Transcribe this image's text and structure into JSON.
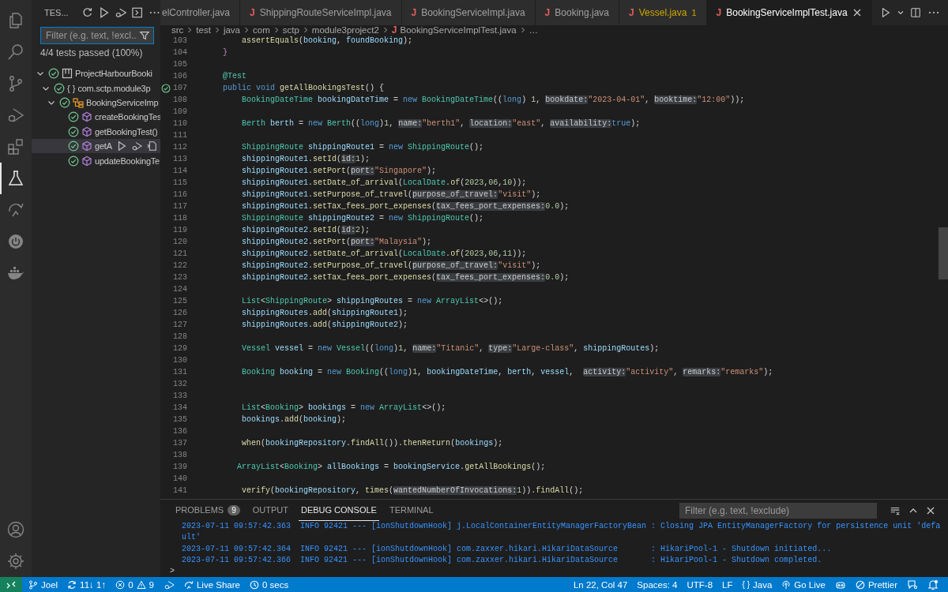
{
  "activity_bar": {
    "items": [
      {
        "kind": "files",
        "selected": false
      },
      {
        "kind": "search",
        "selected": false
      },
      {
        "kind": "source-control",
        "selected": false
      },
      {
        "kind": "run-debug",
        "selected": false
      },
      {
        "kind": "extensions",
        "selected": false
      },
      {
        "kind": "testing",
        "selected": true
      },
      {
        "kind": "remote",
        "selected": false
      },
      {
        "kind": "power",
        "selected": false
      },
      {
        "kind": "whale",
        "selected": false
      }
    ],
    "bottom_items": [
      {
        "kind": "account"
      },
      {
        "kind": "settings"
      }
    ]
  },
  "test_panel": {
    "title": "TES...",
    "filter": {
      "placeholder": "Filter (e.g. text, !excl..."
    },
    "summary": "4/4 tests passed (100%)",
    "tree": [
      {
        "label": "ProjectHarbourBooki",
        "kind": "project",
        "passed": true,
        "expanded": true,
        "selected": false,
        "children": [
          {
            "label": "com.sctp.module3p",
            "kind": "package",
            "glyph": "{ }",
            "passed": true,
            "expanded": true,
            "selected": false,
            "children": [
              {
                "label": "BookingServiceImp",
                "kind": "class",
                "passed": true,
                "expanded": true,
                "selected": false,
                "children": [
                  {
                    "label": "createBookingTes",
                    "kind": "method",
                    "passed": true,
                    "selected": false
                  },
                  {
                    "label": "getBookingTest()",
                    "kind": "method",
                    "passed": true,
                    "selected": false
                  },
                  {
                    "label": "getA",
                    "kind": "method",
                    "passed": true,
                    "selected": true
                  },
                  {
                    "label": "updateBookingTe",
                    "kind": "method",
                    "passed": true,
                    "selected": false
                  }
                ]
              }
            ]
          }
        ]
      }
    ]
  },
  "tabs": [
    {
      "label": "elController.java",
      "selected": false
    },
    {
      "icon": "J",
      "label": "ShippingRouteServiceImpl.java",
      "selected": false
    },
    {
      "icon": "J",
      "label": "BookingServiceImpl.java",
      "selected": false
    },
    {
      "icon": "J",
      "label": "Booking.java",
      "selected": false
    },
    {
      "icon": "J",
      "label": "Vessel.java",
      "selected": false,
      "warning_count": "1"
    },
    {
      "icon": "J",
      "label": "BookingServiceImplTest.java",
      "selected": true
    }
  ],
  "breadcrumb": {
    "segments": [
      "src",
      "test",
      "java",
      "com",
      "sctp",
      "module3project2"
    ],
    "file_icon": "J",
    "file": "BookingServiceImplTest.java",
    "more": "…"
  },
  "editor": {
    "lines": [
      {
        "number": "103",
        "tokens": [
          {
            "text": "        assertEquals",
            "kind": "function"
          },
          {
            "text": "(",
            "kind": "plain"
          },
          {
            "text": "booking",
            "kind": "variable"
          },
          {
            "text": ", ",
            "kind": "plain"
          },
          {
            "text": "foundBooking",
            "kind": "variable"
          },
          {
            "text": ");",
            "kind": "plain"
          }
        ]
      },
      {
        "number": "104",
        "tokens": [
          {
            "text": "    }",
            "kind": "brace"
          }
        ]
      },
      {
        "number": "105"
      },
      {
        "number": "106",
        "tokens": [
          {
            "text": "    @Test",
            "kind": "type"
          }
        ]
      },
      {
        "number": "107",
        "gutter_passed": true,
        "tokens": [
          {
            "text": "    public void ",
            "kind": "keyword"
          },
          {
            "text": "getAllBookingsTest",
            "kind": "function"
          },
          {
            "text": "() {",
            "kind": "plain"
          }
        ]
      },
      {
        "number": "108",
        "tokens": [
          {
            "text": "        BookingDateTime ",
            "kind": "type"
          },
          {
            "text": "bookingDateTime",
            "kind": "variable"
          },
          {
            "text": " = ",
            "kind": "plain"
          },
          {
            "text": "new ",
            "kind": "keyword"
          },
          {
            "text": "BookingDateTime",
            "kind": "type"
          },
          {
            "text": "((",
            "kind": "plain"
          },
          {
            "text": "long",
            "kind": "keyword"
          },
          {
            "text": ") ",
            "kind": "plain"
          },
          {
            "text": "1",
            "kind": "number"
          },
          {
            "text": ", ",
            "kind": "plain"
          },
          {
            "text": "bookdate:",
            "kind": "hint"
          },
          {
            "text": "\"2023-04-01\"",
            "kind": "string"
          },
          {
            "text": ", ",
            "kind": "plain"
          },
          {
            "text": "booktime:",
            "kind": "hint"
          },
          {
            "text": "\"12:00\"",
            "kind": "string"
          },
          {
            "text": "));",
            "kind": "plain"
          }
        ]
      },
      {
        "number": "109"
      },
      {
        "number": "110",
        "tokens": [
          {
            "text": "        Berth ",
            "kind": "type"
          },
          {
            "text": "berth",
            "kind": "variable"
          },
          {
            "text": " = ",
            "kind": "plain"
          },
          {
            "text": "new ",
            "kind": "keyword"
          },
          {
            "text": "Berth",
            "kind": "type"
          },
          {
            "text": "((",
            "kind": "plain"
          },
          {
            "text": "long",
            "kind": "keyword"
          },
          {
            "text": ")",
            "kind": "plain"
          },
          {
            "text": "1",
            "kind": "number"
          },
          {
            "text": ", ",
            "kind": "plain"
          },
          {
            "text": "name:",
            "kind": "hint"
          },
          {
            "text": "\"berth1\"",
            "kind": "string"
          },
          {
            "text": ", ",
            "kind": "plain"
          },
          {
            "text": "location:",
            "kind": "hint"
          },
          {
            "text": "\"east\"",
            "kind": "string"
          },
          {
            "text": ", ",
            "kind": "plain"
          },
          {
            "text": "availability:",
            "kind": "hint"
          },
          {
            "text": "true",
            "kind": "keyword"
          },
          {
            "text": ");",
            "kind": "plain"
          }
        ]
      },
      {
        "number": "111"
      },
      {
        "number": "112",
        "tokens": [
          {
            "text": "        ShippingRoute ",
            "kind": "type"
          },
          {
            "text": "shippingRoute1",
            "kind": "variable"
          },
          {
            "text": " = ",
            "kind": "plain"
          },
          {
            "text": "new ",
            "kind": "keyword"
          },
          {
            "text": "ShippingRoute",
            "kind": "type"
          },
          {
            "text": "();",
            "kind": "plain"
          }
        ]
      },
      {
        "number": "113",
        "tokens": [
          {
            "text": "        shippingRoute1",
            "kind": "variable"
          },
          {
            "text": ".",
            "kind": "plain"
          },
          {
            "text": "setId",
            "kind": "function"
          },
          {
            "text": "(",
            "kind": "plain"
          },
          {
            "text": "id:",
            "kind": "hint"
          },
          {
            "text": "1",
            "kind": "number"
          },
          {
            "text": ");",
            "kind": "plain"
          }
        ]
      },
      {
        "number": "114",
        "tokens": [
          {
            "text": "        shippingRoute1",
            "kind": "variable"
          },
          {
            "text": ".",
            "kind": "plain"
          },
          {
            "text": "setPort",
            "kind": "function"
          },
          {
            "text": "(",
            "kind": "plain"
          },
          {
            "text": "port:",
            "kind": "hint"
          },
          {
            "text": "\"Singapore\"",
            "kind": "string"
          },
          {
            "text": ");",
            "kind": "plain"
          }
        ]
      },
      {
        "number": "115",
        "tokens": [
          {
            "text": "        shippingRoute1",
            "kind": "variable"
          },
          {
            "text": ".",
            "kind": "plain"
          },
          {
            "text": "setDate_of_arrival",
            "kind": "function"
          },
          {
            "text": "(",
            "kind": "plain"
          },
          {
            "text": "LocalDate",
            "kind": "type"
          },
          {
            "text": ".",
            "kind": "plain"
          },
          {
            "text": "of",
            "kind": "function"
          },
          {
            "text": "(",
            "kind": "plain"
          },
          {
            "text": "2023",
            "kind": "number"
          },
          {
            "text": ",",
            "kind": "plain"
          },
          {
            "text": "06",
            "kind": "number"
          },
          {
            "text": ",",
            "kind": "plain"
          },
          {
            "text": "10",
            "kind": "number"
          },
          {
            "text": "));",
            "kind": "plain"
          }
        ]
      },
      {
        "number": "116",
        "tokens": [
          {
            "text": "        shippingRoute1",
            "kind": "variable"
          },
          {
            "text": ".",
            "kind": "plain"
          },
          {
            "text": "setPurpose_of_travel",
            "kind": "function"
          },
          {
            "text": "(",
            "kind": "plain"
          },
          {
            "text": "purpose_of_travel:",
            "kind": "hint"
          },
          {
            "text": "\"visit\"",
            "kind": "string"
          },
          {
            "text": ");",
            "kind": "plain"
          }
        ]
      },
      {
        "number": "117",
        "tokens": [
          {
            "text": "        shippingRoute1",
            "kind": "variable"
          },
          {
            "text": ".",
            "kind": "plain"
          },
          {
            "text": "setTax_fees_port_expenses",
            "kind": "function"
          },
          {
            "text": "(",
            "kind": "plain"
          },
          {
            "text": "tax_fees_port_expenses:",
            "kind": "hint"
          },
          {
            "text": "0.0",
            "kind": "number"
          },
          {
            "text": ");",
            "kind": "plain"
          }
        ]
      },
      {
        "number": "118",
        "tokens": [
          {
            "text": "        ShippingRoute ",
            "kind": "type"
          },
          {
            "text": "shippingRoute2",
            "kind": "variable"
          },
          {
            "text": " = ",
            "kind": "plain"
          },
          {
            "text": "new ",
            "kind": "keyword"
          },
          {
            "text": "ShippingRoute",
            "kind": "type"
          },
          {
            "text": "();",
            "kind": "plain"
          }
        ]
      },
      {
        "number": "119",
        "tokens": [
          {
            "text": "        shippingRoute2",
            "kind": "variable"
          },
          {
            "text": ".",
            "kind": "plain"
          },
          {
            "text": "setId",
            "kind": "function"
          },
          {
            "text": "(",
            "kind": "plain"
          },
          {
            "text": "id:",
            "kind": "hint"
          },
          {
            "text": "2",
            "kind": "number"
          },
          {
            "text": ");",
            "kind": "plain"
          }
        ]
      },
      {
        "number": "120",
        "tokens": [
          {
            "text": "        shippingRoute2",
            "kind": "variable"
          },
          {
            "text": ".",
            "kind": "plain"
          },
          {
            "text": "setPort",
            "kind": "function"
          },
          {
            "text": "(",
            "kind": "plain"
          },
          {
            "text": "port:",
            "kind": "hint"
          },
          {
            "text": "\"Malaysia\"",
            "kind": "string"
          },
          {
            "text": ");",
            "kind": "plain"
          }
        ]
      },
      {
        "number": "121",
        "tokens": [
          {
            "text": "        shippingRoute2",
            "kind": "variable"
          },
          {
            "text": ".",
            "kind": "plain"
          },
          {
            "text": "setDate_of_arrival",
            "kind": "function"
          },
          {
            "text": "(",
            "kind": "plain"
          },
          {
            "text": "LocalDate",
            "kind": "type"
          },
          {
            "text": ".",
            "kind": "plain"
          },
          {
            "text": "of",
            "kind": "function"
          },
          {
            "text": "(",
            "kind": "plain"
          },
          {
            "text": "2023",
            "kind": "number"
          },
          {
            "text": ",",
            "kind": "plain"
          },
          {
            "text": "06",
            "kind": "number"
          },
          {
            "text": ",",
            "kind": "plain"
          },
          {
            "text": "11",
            "kind": "number"
          },
          {
            "text": "));",
            "kind": "plain"
          }
        ]
      },
      {
        "number": "122",
        "tokens": [
          {
            "text": "        shippingRoute2",
            "kind": "variable"
          },
          {
            "text": ".",
            "kind": "plain"
          },
          {
            "text": "setPurpose_of_travel",
            "kind": "function"
          },
          {
            "text": "(",
            "kind": "plain"
          },
          {
            "text": "purpose_of_travel:",
            "kind": "hint"
          },
          {
            "text": "\"visit\"",
            "kind": "string"
          },
          {
            "text": ");",
            "kind": "plain"
          }
        ]
      },
      {
        "number": "123",
        "tokens": [
          {
            "text": "        shippingRoute2",
            "kind": "variable"
          },
          {
            "text": ".",
            "kind": "plain"
          },
          {
            "text": "setTax_fees_port_expenses",
            "kind": "function"
          },
          {
            "text": "(",
            "kind": "plain"
          },
          {
            "text": "tax_fees_port_expenses:",
            "kind": "hint"
          },
          {
            "text": "0.0",
            "kind": "number"
          },
          {
            "text": ");",
            "kind": "plain"
          }
        ]
      },
      {
        "number": "124"
      },
      {
        "number": "125",
        "tokens": [
          {
            "text": "        List",
            "kind": "type"
          },
          {
            "text": "<",
            "kind": "plain"
          },
          {
            "text": "ShippingRoute",
            "kind": "type"
          },
          {
            "text": "> ",
            "kind": "plain"
          },
          {
            "text": "shippingRoutes",
            "kind": "variable"
          },
          {
            "text": " = ",
            "kind": "plain"
          },
          {
            "text": "new ",
            "kind": "keyword"
          },
          {
            "text": "ArrayList",
            "kind": "type"
          },
          {
            "text": "<>();",
            "kind": "plain"
          }
        ]
      },
      {
        "number": "126",
        "tokens": [
          {
            "text": "        shippingRoutes",
            "kind": "variable"
          },
          {
            "text": ".",
            "kind": "plain"
          },
          {
            "text": "add",
            "kind": "function"
          },
          {
            "text": "(",
            "kind": "plain"
          },
          {
            "text": "shippingRoute1",
            "kind": "variable"
          },
          {
            "text": ");",
            "kind": "plain"
          }
        ]
      },
      {
        "number": "127",
        "tokens": [
          {
            "text": "        shippingRoutes",
            "kind": "variable"
          },
          {
            "text": ".",
            "kind": "plain"
          },
          {
            "text": "add",
            "kind": "function"
          },
          {
            "text": "(",
            "kind": "plain"
          },
          {
            "text": "shippingRoute2",
            "kind": "variable"
          },
          {
            "text": ");",
            "kind": "plain"
          }
        ]
      },
      {
        "number": "128"
      },
      {
        "number": "129",
        "tokens": [
          {
            "text": "        Vessel ",
            "kind": "type"
          },
          {
            "text": "vessel",
            "kind": "variable"
          },
          {
            "text": " = ",
            "kind": "plain"
          },
          {
            "text": "new ",
            "kind": "keyword"
          },
          {
            "text": "Vessel",
            "kind": "type"
          },
          {
            "text": "((",
            "kind": "plain"
          },
          {
            "text": "long",
            "kind": "keyword"
          },
          {
            "text": ")",
            "kind": "plain"
          },
          {
            "text": "1",
            "kind": "number"
          },
          {
            "text": ", ",
            "kind": "plain"
          },
          {
            "text": "name:",
            "kind": "hint"
          },
          {
            "text": "\"Titanic\"",
            "kind": "string"
          },
          {
            "text": ", ",
            "kind": "plain"
          },
          {
            "text": "type:",
            "kind": "hint"
          },
          {
            "text": "\"Large-class\"",
            "kind": "string"
          },
          {
            "text": ", ",
            "kind": "plain"
          },
          {
            "text": "shippingRoutes",
            "kind": "variable"
          },
          {
            "text": ");",
            "kind": "plain"
          }
        ]
      },
      {
        "number": "130"
      },
      {
        "number": "131",
        "tokens": [
          {
            "text": "        Booking ",
            "kind": "type"
          },
          {
            "text": "booking",
            "kind": "variable"
          },
          {
            "text": " = ",
            "kind": "plain"
          },
          {
            "text": "new ",
            "kind": "keyword"
          },
          {
            "text": "Booking",
            "kind": "type"
          },
          {
            "text": "((",
            "kind": "plain"
          },
          {
            "text": "long",
            "kind": "keyword"
          },
          {
            "text": ")",
            "kind": "plain"
          },
          {
            "text": "1",
            "kind": "number"
          },
          {
            "text": ", ",
            "kind": "plain"
          },
          {
            "text": "bookingDateTime",
            "kind": "variable"
          },
          {
            "text": ", ",
            "kind": "plain"
          },
          {
            "text": "berth",
            "kind": "variable"
          },
          {
            "text": ", ",
            "kind": "plain"
          },
          {
            "text": "vessel",
            "kind": "variable"
          },
          {
            "text": ",  ",
            "kind": "plain"
          },
          {
            "text": "activity:",
            "kind": "hint"
          },
          {
            "text": "\"activity\"",
            "kind": "string"
          },
          {
            "text": ", ",
            "kind": "plain"
          },
          {
            "text": "remarks:",
            "kind": "hint"
          },
          {
            "text": "\"remarks\"",
            "kind": "string"
          },
          {
            "text": ");",
            "kind": "plain"
          }
        ]
      },
      {
        "number": "132"
      },
      {
        "number": "133"
      },
      {
        "number": "134",
        "tokens": [
          {
            "text": "        List",
            "kind": "type"
          },
          {
            "text": "<",
            "kind": "plain"
          },
          {
            "text": "Booking",
            "kind": "type"
          },
          {
            "text": "> ",
            "kind": "plain"
          },
          {
            "text": "bookings",
            "kind": "variable"
          },
          {
            "text": " = ",
            "kind": "plain"
          },
          {
            "text": "new ",
            "kind": "keyword"
          },
          {
            "text": "ArrayList",
            "kind": "type"
          },
          {
            "text": "<>();",
            "kind": "plain"
          }
        ]
      },
      {
        "number": "135",
        "tokens": [
          {
            "text": "        bookings",
            "kind": "variable"
          },
          {
            "text": ".",
            "kind": "plain"
          },
          {
            "text": "add",
            "kind": "function"
          },
          {
            "text": "(",
            "kind": "plain"
          },
          {
            "text": "booking",
            "kind": "variable"
          },
          {
            "text": ");",
            "kind": "plain"
          }
        ]
      },
      {
        "number": "136"
      },
      {
        "number": "137",
        "tokens": [
          {
            "text": "        when",
            "kind": "function"
          },
          {
            "text": "(",
            "kind": "plain"
          },
          {
            "text": "bookingRepository",
            "kind": "variable"
          },
          {
            "text": ".",
            "kind": "plain"
          },
          {
            "text": "findAll",
            "kind": "function"
          },
          {
            "text": "()).",
            "kind": "plain"
          },
          {
            "text": "thenReturn",
            "kind": "function"
          },
          {
            "text": "(",
            "kind": "plain"
          },
          {
            "text": "bookings",
            "kind": "variable"
          },
          {
            "text": ");",
            "kind": "plain"
          }
        ]
      },
      {
        "number": "138"
      },
      {
        "number": "139",
        "tokens": [
          {
            "text": "       ArrayList",
            "kind": "type"
          },
          {
            "text": "<",
            "kind": "plain"
          },
          {
            "text": "Booking",
            "kind": "type"
          },
          {
            "text": "> ",
            "kind": "plain"
          },
          {
            "text": "allBookings",
            "kind": "variable"
          },
          {
            "text": " = ",
            "kind": "plain"
          },
          {
            "text": "bookingService",
            "kind": "variable"
          },
          {
            "text": ".",
            "kind": "plain"
          },
          {
            "text": "getAllBookings",
            "kind": "function"
          },
          {
            "text": "();",
            "kind": "plain"
          }
        ]
      },
      {
        "number": "140"
      },
      {
        "number": "141",
        "tokens": [
          {
            "text": "        verify",
            "kind": "function"
          },
          {
            "text": "(",
            "kind": "plain"
          },
          {
            "text": "bookingRepository",
            "kind": "variable"
          },
          {
            "text": ", ",
            "kind": "plain"
          },
          {
            "text": "times",
            "kind": "function"
          },
          {
            "text": "(",
            "kind": "plain"
          },
          {
            "text": "wantedNumberOfInvocations:",
            "kind": "hint"
          },
          {
            "text": "1",
            "kind": "number"
          },
          {
            "text": ")).",
            "kind": "plain"
          },
          {
            "text": "findAll",
            "kind": "function"
          },
          {
            "text": "();",
            "kind": "plain"
          }
        ]
      }
    ]
  },
  "panel": {
    "tabs": [
      {
        "label": "PROBLEMS",
        "badge": "9",
        "selected": false
      },
      {
        "label": "OUTPUT",
        "selected": false
      },
      {
        "label": "DEBUG CONSOLE",
        "selected": true
      },
      {
        "label": "TERMINAL",
        "selected": false
      }
    ],
    "filter": {
      "placeholder": "Filter (e.g. text, !exclude)"
    },
    "console_lines": [
      "2023-07-11 09:57:42.363  INFO 92421 --- [ionShutdownHook] j.LocalContainerEntityManagerFactoryBean : Closing JPA EntityManagerFactory for persistence unit 'defa",
      "ult'",
      "2023-07-11 09:57:42.364  INFO 92421 --- [ionShutdownHook] com.zaxxer.hikari.HikariDataSource       : HikariPool-1 - Shutdown initiated...",
      "2023-07-11 09:57:42.366  INFO 92421 --- [ionShutdownHook] com.zaxxer.hikari.HikariDataSource       : HikariPool-1 - Shutdown completed."
    ],
    "prompt": ">"
  },
  "status_bar": {
    "branch": "Joel",
    "sync": "11↓ 1↑",
    "errors": "0",
    "warnings": "9",
    "live_share": "Live Share",
    "timer": "0 secs",
    "position": "Ln 22, Col 47",
    "spaces": "Spaces: 4",
    "encoding": "UTF-8",
    "eol": "LF",
    "language_glyph": "{ }",
    "language": "Java",
    "go_live": "Go Live",
    "formatter": "Prettier"
  }
}
